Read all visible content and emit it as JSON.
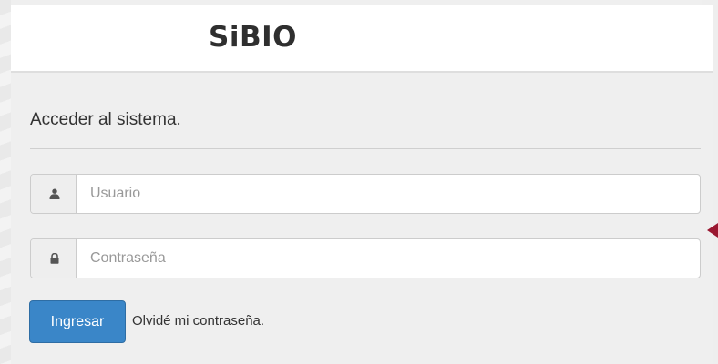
{
  "header": {
    "logo_text": "SiBIO"
  },
  "login": {
    "title": "Acceder al sistema.",
    "username": {
      "placeholder": "Usuario",
      "value": "",
      "icon": "user-icon"
    },
    "password": {
      "placeholder": "Contraseña",
      "value": "",
      "icon": "lock-icon"
    },
    "submit_label": "Ingresar",
    "forgot_label": "Olvidé mi contraseña."
  },
  "colors": {
    "primary_button": "#3a86c8",
    "accent_arrow": "#9a1730",
    "background": "#efefef"
  }
}
